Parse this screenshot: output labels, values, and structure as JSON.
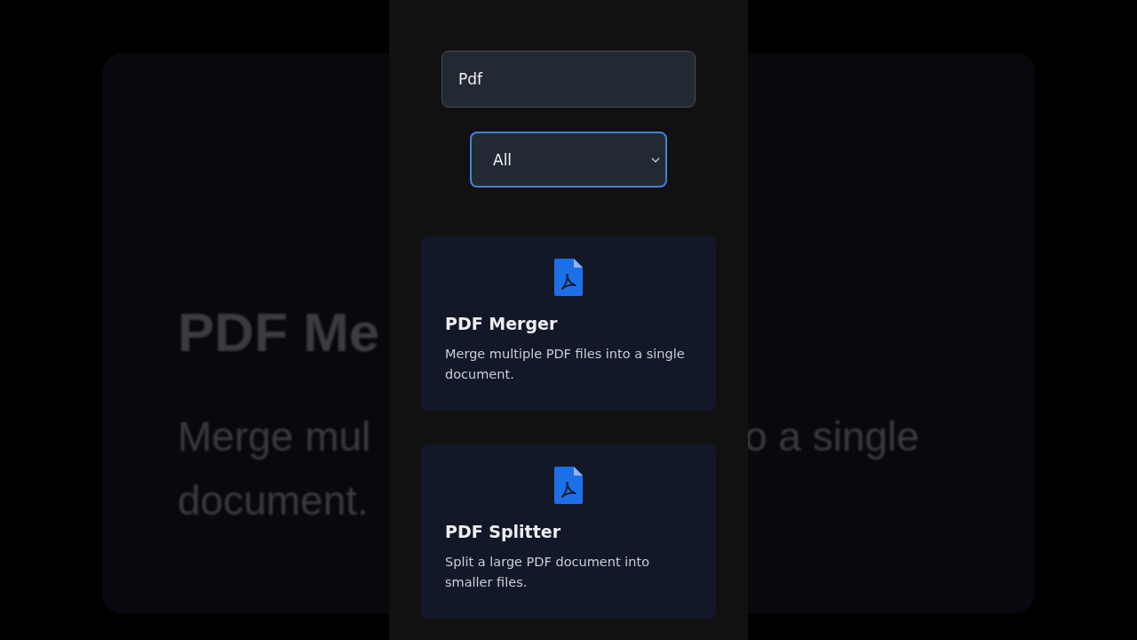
{
  "backdrop": {
    "texts": [
      {
        "kind": "title",
        "text": "PDF Me"
      },
      {
        "kind": "body_left",
        "text": "Merge mul"
      },
      {
        "kind": "body_right",
        "text": "o a single"
      },
      {
        "kind": "body_left2",
        "text": "document."
      }
    ]
  },
  "search": {
    "value": "Pdf"
  },
  "category_select": {
    "value": "All",
    "focused": true
  },
  "tools": [
    {
      "title": "PDF Merger",
      "description": "Merge multiple PDF files into a single document."
    },
    {
      "title": "PDF Splitter",
      "description": "Split a large PDF document into smaller files."
    }
  ]
}
